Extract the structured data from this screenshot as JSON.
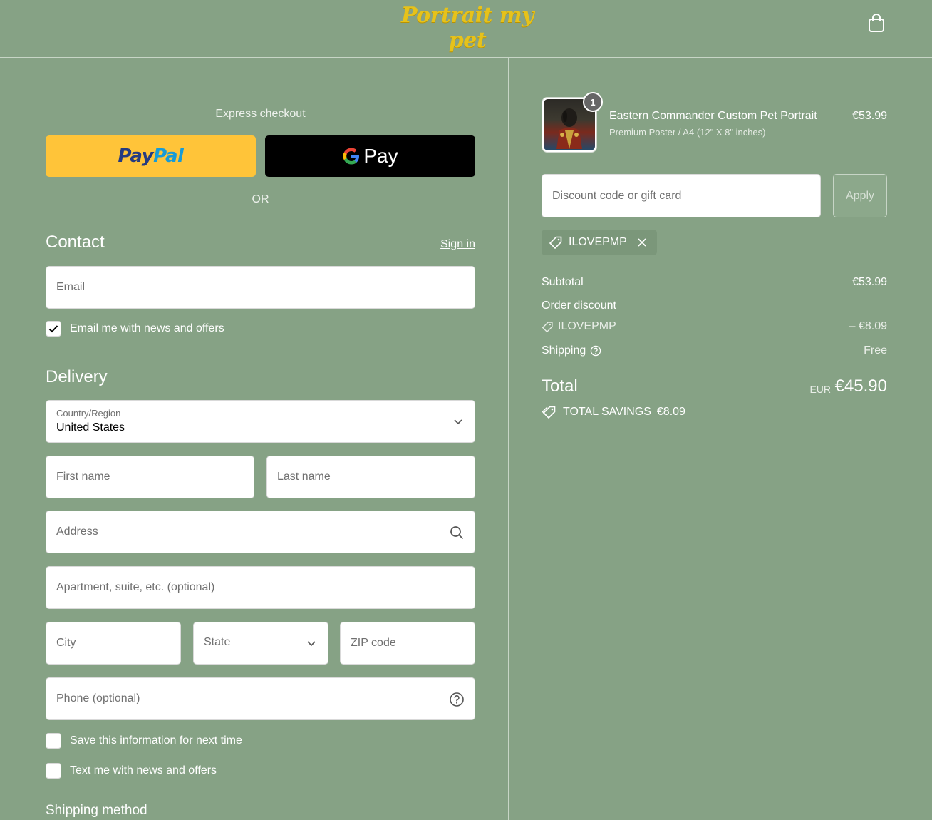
{
  "brand": {
    "logo_text": "Portrait my pet",
    "logo_color": "#e6c21b"
  },
  "header": {
    "cart_icon": "shopping-bag-icon"
  },
  "express": {
    "title": "Express checkout",
    "paypal": {
      "part1": "Pay",
      "part2": "Pal",
      "color": "#ffc439"
    },
    "gpay": {
      "g": "G",
      "label": "Pay"
    },
    "or_label": "OR"
  },
  "contact": {
    "title": "Contact",
    "sign_in": "Sign in",
    "email_placeholder": "Email",
    "news_checkbox": {
      "label": "Email me with news and offers",
      "checked": true
    }
  },
  "delivery": {
    "title": "Delivery",
    "country": {
      "label": "Country/Region",
      "value": "United States"
    },
    "first_name_placeholder": "First name",
    "last_name_placeholder": "Last name",
    "address_placeholder": "Address",
    "apartment_placeholder": "Apartment, suite, etc. (optional)",
    "city_placeholder": "City",
    "state_label": "State",
    "zip_placeholder": "ZIP code",
    "phone_placeholder": "Phone (optional)",
    "save_info": {
      "label": "Save this information for next time",
      "checked": false
    },
    "text_me": {
      "label": "Text me with news and offers",
      "checked": false
    }
  },
  "shipping_method": {
    "title": "Shipping method"
  },
  "order": {
    "item": {
      "quantity": "1",
      "name": "Eastern Commander Custom Pet Portrait",
      "variant": "Premium Poster / A4 (12\" X 8\" inches)",
      "price": "€53.99"
    },
    "discount_placeholder": "Discount code or gift card",
    "apply_label": "Apply",
    "applied_code": "ILOVEPMP",
    "subtotal_label": "Subtotal",
    "subtotal_value": "€53.99",
    "order_discount_label": "Order discount",
    "discount_code": "ILOVEPMP",
    "discount_value": "– €8.09",
    "shipping_label": "Shipping",
    "shipping_value": "Free",
    "total_label": "Total",
    "total_currency": "EUR",
    "total_value": "€45.90",
    "savings_label": "TOTAL SAVINGS",
    "savings_value": "€8.09"
  }
}
